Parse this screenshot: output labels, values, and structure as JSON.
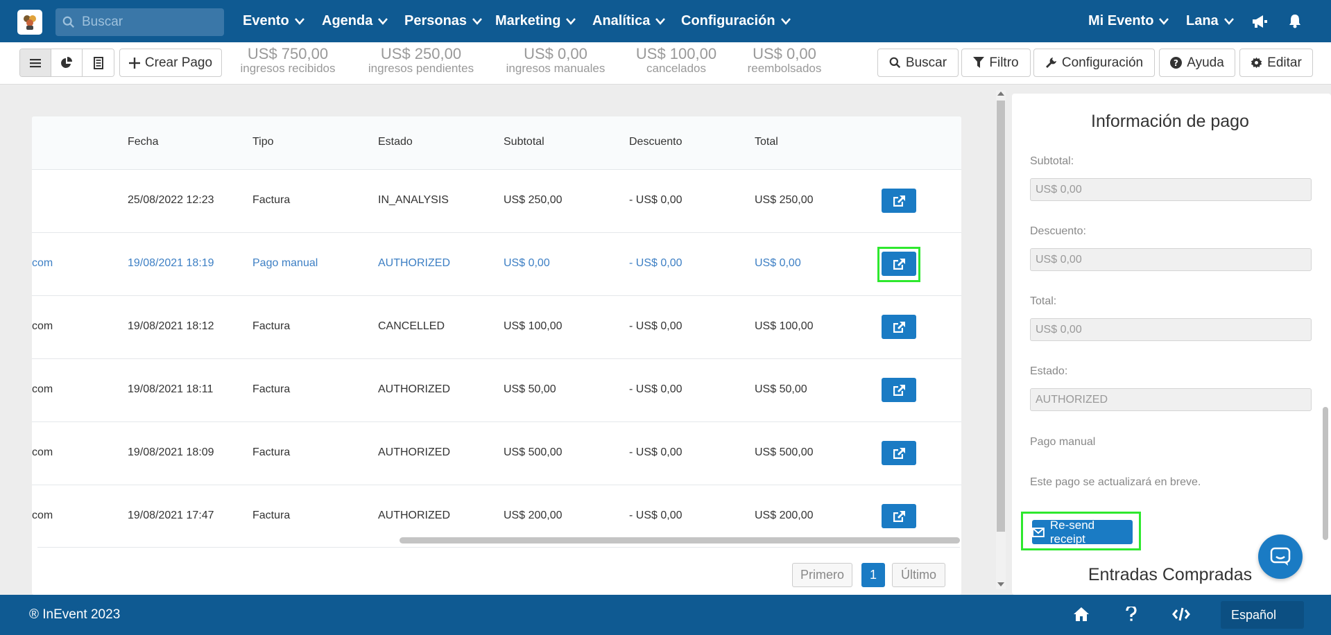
{
  "nav": {
    "search_placeholder": "Buscar",
    "menus": [
      "Evento",
      "Agenda",
      "Personas",
      "Marketing",
      "Analítica",
      "Configuración"
    ],
    "event_menu": "Mi Evento",
    "user_menu": "Lana"
  },
  "toolbar": {
    "create_label": "Crear Pago",
    "stats": [
      {
        "value": "US$ 750,00",
        "label": "ingresos recibidos"
      },
      {
        "value": "US$ 250,00",
        "label": "ingresos pendientes"
      },
      {
        "value": "US$ 0,00",
        "label": "ingresos manuales"
      },
      {
        "value": "US$ 100,00",
        "label": "cancelados"
      },
      {
        "value": "US$ 0,00",
        "label": "reembolsados"
      }
    ],
    "search_label": "Buscar",
    "filter_label": "Filtro",
    "config_label": "Configuración",
    "help_label": "Ayuda",
    "edit_label": "Editar"
  },
  "table": {
    "headers": [
      "Fecha",
      "Tipo",
      "Estado",
      "Subtotal",
      "Descuento",
      "Total"
    ],
    "rows": [
      {
        "email_tail": "",
        "fecha": "25/08/2022 12:23",
        "tipo": "Factura",
        "estado": "IN_ANALYSIS",
        "subtotal": "US$ 250,00",
        "descuento": "- US$ 0,00",
        "total": "US$ 250,00"
      },
      {
        "email_tail": "com",
        "fecha": "19/08/2021 18:19",
        "tipo": "Pago manual",
        "estado": "AUTHORIZED",
        "subtotal": "US$ 0,00",
        "descuento": "- US$ 0,00",
        "total": "US$ 0,00"
      },
      {
        "email_tail": "com",
        "fecha": "19/08/2021 18:12",
        "tipo": "Factura",
        "estado": "CANCELLED",
        "subtotal": "US$ 100,00",
        "descuento": "- US$ 0,00",
        "total": "US$ 100,00"
      },
      {
        "email_tail": "com",
        "fecha": "19/08/2021 18:11",
        "tipo": "Factura",
        "estado": "AUTHORIZED",
        "subtotal": "US$ 50,00",
        "descuento": "- US$ 0,00",
        "total": "US$ 50,00"
      },
      {
        "email_tail": "com",
        "fecha": "19/08/2021 18:09",
        "tipo": "Factura",
        "estado": "AUTHORIZED",
        "subtotal": "US$ 500,00",
        "descuento": "- US$ 0,00",
        "total": "US$ 500,00"
      },
      {
        "email_tail": "com",
        "fecha": "19/08/2021 17:47",
        "tipo": "Factura",
        "estado": "AUTHORIZED",
        "subtotal": "US$ 200,00",
        "descuento": "- US$ 0,00",
        "total": "US$ 200,00"
      }
    ],
    "pager": {
      "first": "Primero",
      "current": "1",
      "last": "Último"
    }
  },
  "panel": {
    "title": "Información de pago",
    "subtotal_label": "Subtotal:",
    "subtotal_value": "US$ 0,00",
    "discount_label": "Descuento:",
    "discount_value": "US$ 0,00",
    "total_label": "Total:",
    "total_value": "US$ 0,00",
    "status_label": "Estado:",
    "status_value": "AUTHORIZED",
    "type_text": "Pago manual",
    "note_text": "Este pago se actualizará en breve.",
    "resend_label": "Re-send receipt",
    "tickets_title": "Entradas Compradas"
  },
  "footer": {
    "copyright": "® InEvent 2023",
    "language": "Español"
  },
  "colors": {
    "brand": "#0f5a92",
    "button": "#1a7bc4",
    "highlight": "#2ee82e",
    "link": "#3d7fc4"
  }
}
